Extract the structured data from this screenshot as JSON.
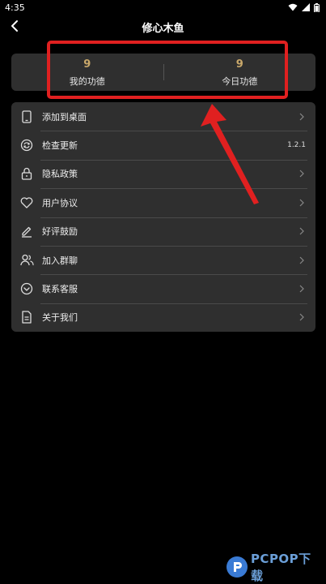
{
  "status_bar": {
    "time": "4:35",
    "icons": [
      "wifi-icon",
      "signal-icon",
      "battery-icon"
    ]
  },
  "app_bar": {
    "title": "修心木鱼",
    "back_icon": "back-arrow-icon"
  },
  "stats": {
    "my_merit_value": "9",
    "my_merit_label": "我的功德",
    "today_merit_value": "9",
    "today_merit_label": "今日功德"
  },
  "menu": {
    "items": [
      {
        "label": "添加到桌面",
        "icon": "phone-icon",
        "value": ""
      },
      {
        "label": "检查更新",
        "icon": "refresh-icon",
        "value": "1.2.1"
      },
      {
        "label": "隐私政策",
        "icon": "lock-icon",
        "value": ""
      },
      {
        "label": "用户协议",
        "icon": "heart-icon",
        "value": ""
      },
      {
        "label": "好评鼓励",
        "icon": "pencil-icon",
        "value": ""
      },
      {
        "label": "加入群聊",
        "icon": "group-icon",
        "value": ""
      },
      {
        "label": "联系客服",
        "icon": "service-icon",
        "value": ""
      },
      {
        "label": "关于我们",
        "icon": "document-icon",
        "value": ""
      }
    ]
  },
  "watermark": {
    "text": "PCPOP下载"
  },
  "colors": {
    "background": "#000000",
    "card": "#2f2f2f",
    "accent_gold": "#c9a86a",
    "annotation_red": "#e02020"
  }
}
